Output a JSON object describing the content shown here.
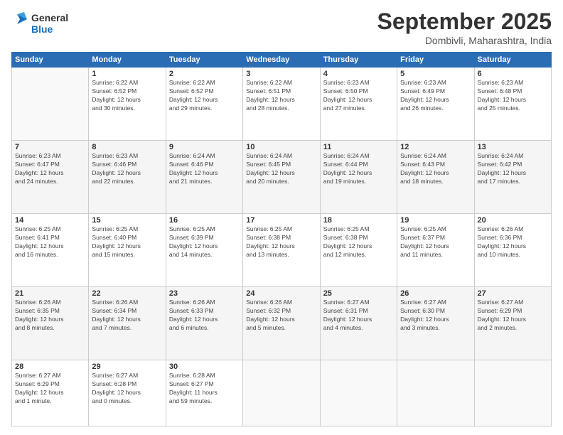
{
  "logo": {
    "general": "General",
    "blue": "Blue"
  },
  "header": {
    "month": "September 2025",
    "location": "Dombivli, Maharashtra, India"
  },
  "weekdays": [
    "Sunday",
    "Monday",
    "Tuesday",
    "Wednesday",
    "Thursday",
    "Friday",
    "Saturday"
  ],
  "weeks": [
    [
      {
        "day": "",
        "info": ""
      },
      {
        "day": "1",
        "info": "Sunrise: 6:22 AM\nSunset: 6:52 PM\nDaylight: 12 hours\nand 30 minutes."
      },
      {
        "day": "2",
        "info": "Sunrise: 6:22 AM\nSunset: 6:52 PM\nDaylight: 12 hours\nand 29 minutes."
      },
      {
        "day": "3",
        "info": "Sunrise: 6:22 AM\nSunset: 6:51 PM\nDaylight: 12 hours\nand 28 minutes."
      },
      {
        "day": "4",
        "info": "Sunrise: 6:23 AM\nSunset: 6:50 PM\nDaylight: 12 hours\nand 27 minutes."
      },
      {
        "day": "5",
        "info": "Sunrise: 6:23 AM\nSunset: 6:49 PM\nDaylight: 12 hours\nand 26 minutes."
      },
      {
        "day": "6",
        "info": "Sunrise: 6:23 AM\nSunset: 6:48 PM\nDaylight: 12 hours\nand 25 minutes."
      }
    ],
    [
      {
        "day": "7",
        "info": "Sunrise: 6:23 AM\nSunset: 6:47 PM\nDaylight: 12 hours\nand 24 minutes."
      },
      {
        "day": "8",
        "info": "Sunrise: 6:23 AM\nSunset: 6:46 PM\nDaylight: 12 hours\nand 22 minutes."
      },
      {
        "day": "9",
        "info": "Sunrise: 6:24 AM\nSunset: 6:46 PM\nDaylight: 12 hours\nand 21 minutes."
      },
      {
        "day": "10",
        "info": "Sunrise: 6:24 AM\nSunset: 6:45 PM\nDaylight: 12 hours\nand 20 minutes."
      },
      {
        "day": "11",
        "info": "Sunrise: 6:24 AM\nSunset: 6:44 PM\nDaylight: 12 hours\nand 19 minutes."
      },
      {
        "day": "12",
        "info": "Sunrise: 6:24 AM\nSunset: 6:43 PM\nDaylight: 12 hours\nand 18 minutes."
      },
      {
        "day": "13",
        "info": "Sunrise: 6:24 AM\nSunset: 6:42 PM\nDaylight: 12 hours\nand 17 minutes."
      }
    ],
    [
      {
        "day": "14",
        "info": "Sunrise: 6:25 AM\nSunset: 6:41 PM\nDaylight: 12 hours\nand 16 minutes."
      },
      {
        "day": "15",
        "info": "Sunrise: 6:25 AM\nSunset: 6:40 PM\nDaylight: 12 hours\nand 15 minutes."
      },
      {
        "day": "16",
        "info": "Sunrise: 6:25 AM\nSunset: 6:39 PM\nDaylight: 12 hours\nand 14 minutes."
      },
      {
        "day": "17",
        "info": "Sunrise: 6:25 AM\nSunset: 6:38 PM\nDaylight: 12 hours\nand 13 minutes."
      },
      {
        "day": "18",
        "info": "Sunrise: 6:25 AM\nSunset: 6:38 PM\nDaylight: 12 hours\nand 12 minutes."
      },
      {
        "day": "19",
        "info": "Sunrise: 6:25 AM\nSunset: 6:37 PM\nDaylight: 12 hours\nand 11 minutes."
      },
      {
        "day": "20",
        "info": "Sunrise: 6:26 AM\nSunset: 6:36 PM\nDaylight: 12 hours\nand 10 minutes."
      }
    ],
    [
      {
        "day": "21",
        "info": "Sunrise: 6:26 AM\nSunset: 6:35 PM\nDaylight: 12 hours\nand 8 minutes."
      },
      {
        "day": "22",
        "info": "Sunrise: 6:26 AM\nSunset: 6:34 PM\nDaylight: 12 hours\nand 7 minutes."
      },
      {
        "day": "23",
        "info": "Sunrise: 6:26 AM\nSunset: 6:33 PM\nDaylight: 12 hours\nand 6 minutes."
      },
      {
        "day": "24",
        "info": "Sunrise: 6:26 AM\nSunset: 6:32 PM\nDaylight: 12 hours\nand 5 minutes."
      },
      {
        "day": "25",
        "info": "Sunrise: 6:27 AM\nSunset: 6:31 PM\nDaylight: 12 hours\nand 4 minutes."
      },
      {
        "day": "26",
        "info": "Sunrise: 6:27 AM\nSunset: 6:30 PM\nDaylight: 12 hours\nand 3 minutes."
      },
      {
        "day": "27",
        "info": "Sunrise: 6:27 AM\nSunset: 6:29 PM\nDaylight: 12 hours\nand 2 minutes."
      }
    ],
    [
      {
        "day": "28",
        "info": "Sunrise: 6:27 AM\nSunset: 6:29 PM\nDaylight: 12 hours\nand 1 minute."
      },
      {
        "day": "29",
        "info": "Sunrise: 6:27 AM\nSunset: 6:28 PM\nDaylight: 12 hours\nand 0 minutes."
      },
      {
        "day": "30",
        "info": "Sunrise: 6:28 AM\nSunset: 6:27 PM\nDaylight: 11 hours\nand 59 minutes."
      },
      {
        "day": "",
        "info": ""
      },
      {
        "day": "",
        "info": ""
      },
      {
        "day": "",
        "info": ""
      },
      {
        "day": "",
        "info": ""
      }
    ]
  ]
}
